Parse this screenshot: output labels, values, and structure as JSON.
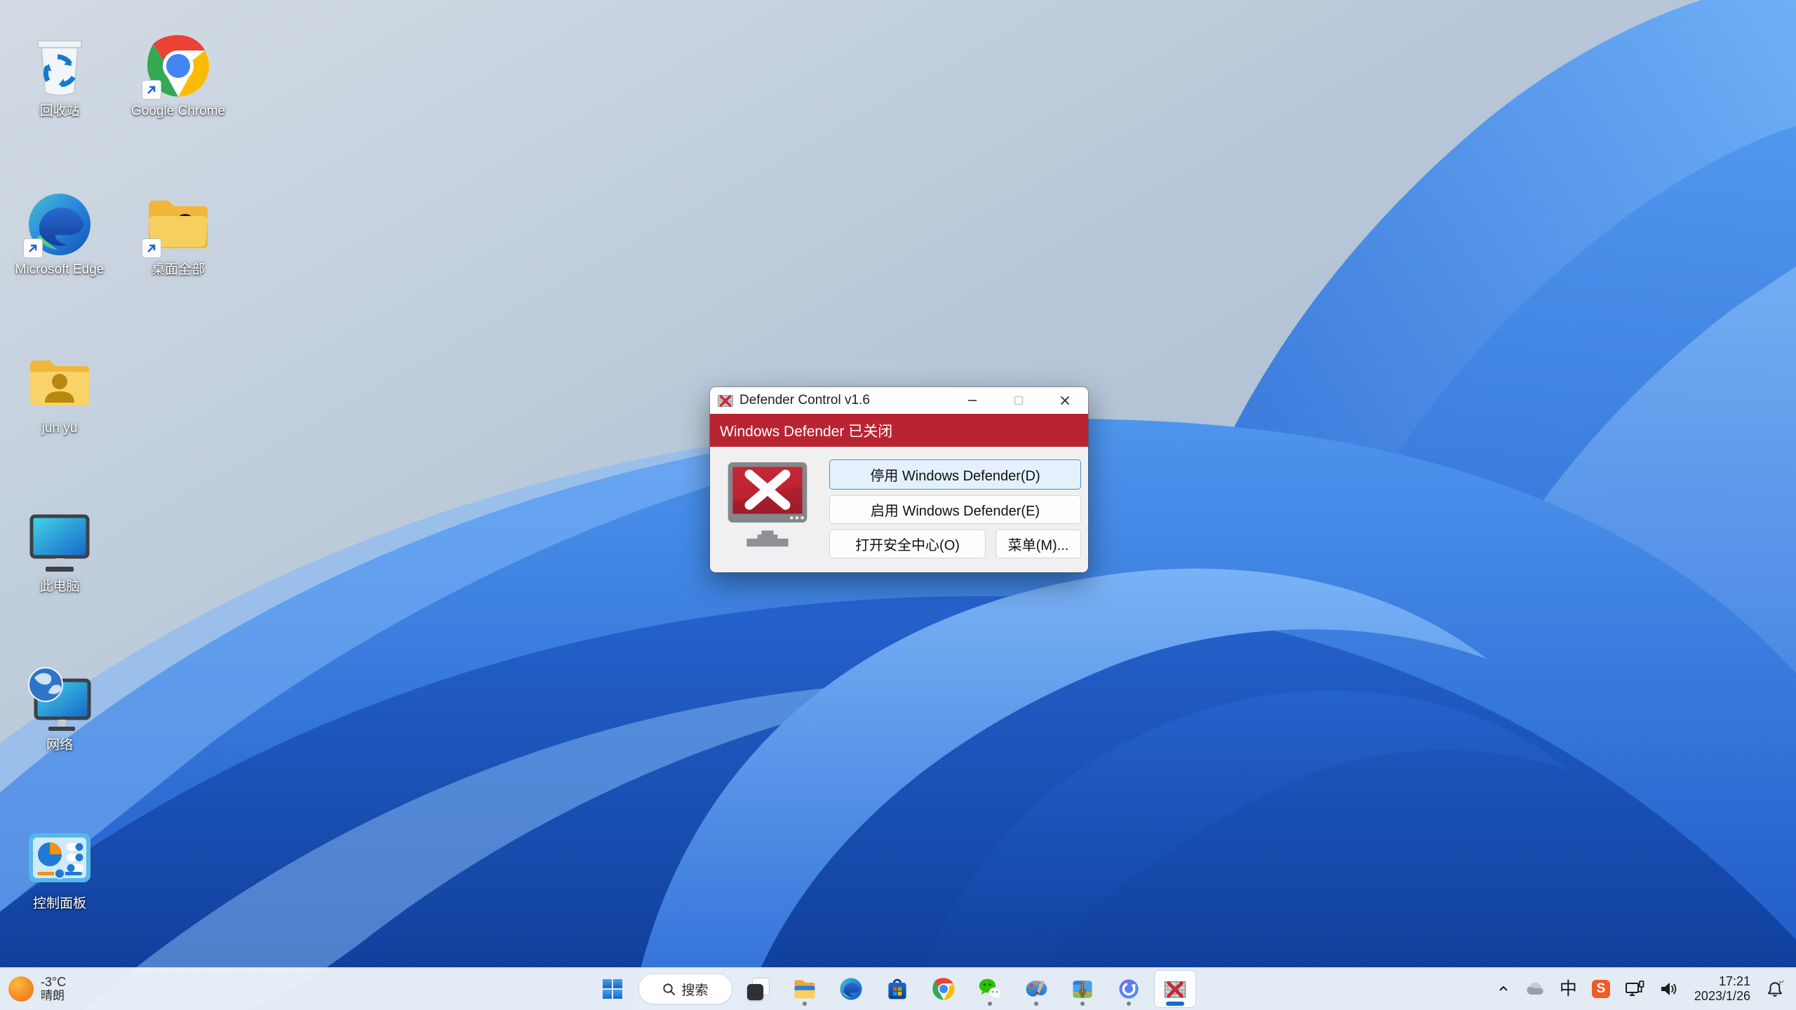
{
  "desktop": {
    "icons": [
      {
        "name": "recycle-bin",
        "label": "回收站",
        "shortcut": false
      },
      {
        "name": "google-chrome",
        "label": "Google Chrome",
        "shortcut": true
      },
      {
        "name": "microsoft-edge",
        "label": "Microsoft Edge",
        "shortcut": true
      },
      {
        "name": "desktop-all",
        "label": "桌面全部",
        "shortcut": true
      },
      {
        "name": "user-folder",
        "label": "jun yu",
        "shortcut": false
      },
      {
        "name": "this-pc",
        "label": "此电脑",
        "shortcut": false
      },
      {
        "name": "network",
        "label": "网络",
        "shortcut": false
      },
      {
        "name": "control-panel",
        "label": "控制面板",
        "shortcut": false
      }
    ]
  },
  "defender_window": {
    "title": "Defender Control v1.6",
    "status_banner": "Windows Defender 已关闭",
    "buttons": {
      "disable": "停用 Windows Defender(D)",
      "enable": "启用 Windows Defender(E)",
      "open_security_center": "打开安全中心(O)",
      "menu": "菜单(M)..."
    },
    "colors": {
      "banner_bg": "#b92433",
      "body_bg": "#f0f0f0",
      "accent_border": "#3f8fd6",
      "accent_fill": "#e4f0fb"
    }
  },
  "taskbar": {
    "weather": {
      "temperature": "-3°C",
      "condition": "晴朗"
    },
    "search": {
      "placeholder": "搜索"
    },
    "apps": [
      {
        "name": "start",
        "running": false,
        "active": false
      },
      {
        "name": "task-view",
        "running": false,
        "active": false
      },
      {
        "name": "file-explorer",
        "running": true,
        "active": false
      },
      {
        "name": "microsoft-edge",
        "running": false,
        "active": false
      },
      {
        "name": "microsoft-store",
        "running": false,
        "active": false
      },
      {
        "name": "google-chrome",
        "running": false,
        "active": false
      },
      {
        "name": "wechat",
        "running": true,
        "active": false
      },
      {
        "name": "paint",
        "running": true,
        "active": false
      },
      {
        "name": "360zip",
        "running": true,
        "active": false
      },
      {
        "name": "loop-app",
        "running": true,
        "active": false
      },
      {
        "name": "defender-control",
        "running": true,
        "active": true
      }
    ],
    "tray": {
      "ime_indicator": "中",
      "time": "17:21",
      "date": "2023/1/26"
    }
  }
}
